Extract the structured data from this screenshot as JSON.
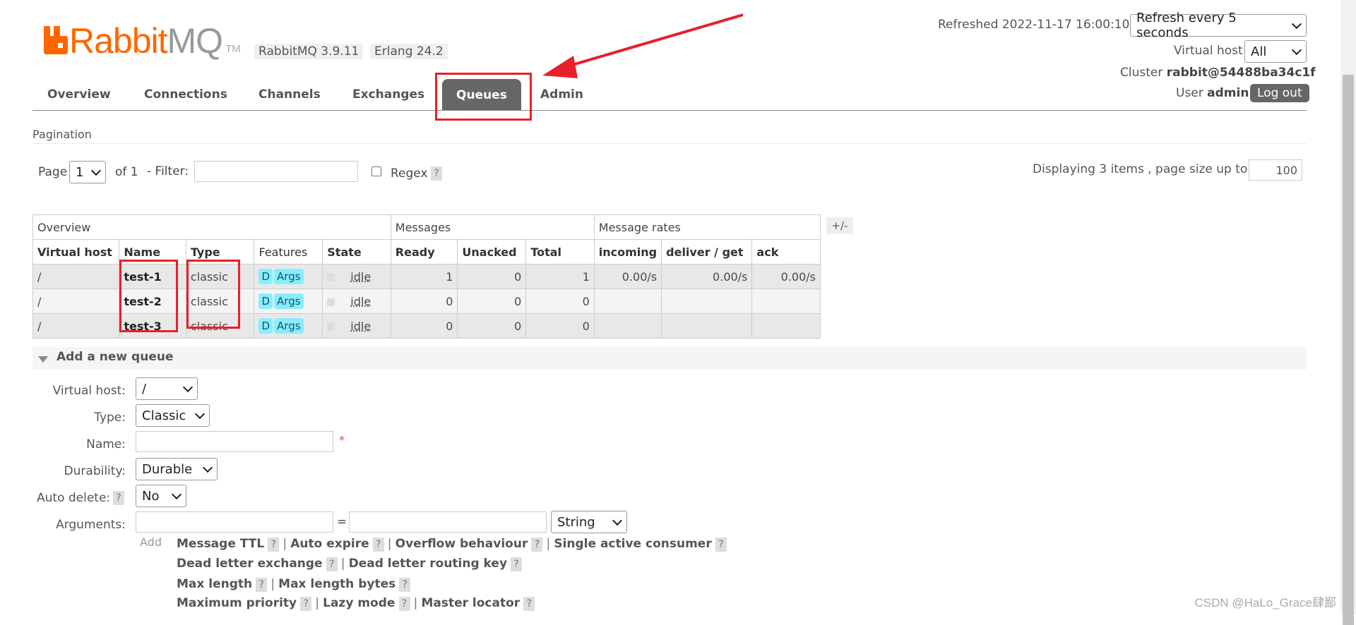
{
  "header": {
    "logo_rabbit": "Rabbit",
    "logo_mq": "MQ",
    "logo_tm": "TM",
    "version": "RabbitMQ 3.9.11",
    "erlang": "Erlang 24.2",
    "refreshed_label": "Refreshed 2022-11-17 16:00:10",
    "refresh_select": "Refresh every 5 seconds",
    "virtual_host_label": "Virtual host",
    "virtual_host_select": "All",
    "cluster_label": "Cluster",
    "cluster_value": "rabbit@54488ba34c1f",
    "user_label": "User",
    "user_value": "admin",
    "logout": "Log out"
  },
  "tabs": [
    "Overview",
    "Connections",
    "Channels",
    "Exchanges",
    "Queues",
    "Admin"
  ],
  "active_tab": "Queues",
  "pagination": {
    "title": "Pagination",
    "page_label": "Page",
    "page_value": "1",
    "of_label": "of 1",
    "filter_label": "- Filter:",
    "filter_value": "",
    "regex_label": "Regex",
    "help": "?",
    "displaying": "Displaying 3 items , page size up to:",
    "page_size": "100"
  },
  "table": {
    "groups": [
      "Overview",
      "Messages",
      "Message rates"
    ],
    "plusminus": "+/-",
    "columns": [
      "Virtual host",
      "Name",
      "Type",
      "Features",
      "State",
      "Ready",
      "Unacked",
      "Total",
      "incoming",
      "deliver / get",
      "ack"
    ],
    "rows": [
      {
        "vhost": "/",
        "name": "test-1",
        "type": "classic",
        "feat_d": "D",
        "feat_args": "Args",
        "state": "idle",
        "ready": "1",
        "unacked": "0",
        "total": "1",
        "incoming": "0.00/s",
        "deliver": "0.00/s",
        "ack": "0.00/s"
      },
      {
        "vhost": "/",
        "name": "test-2",
        "type": "classic",
        "feat_d": "D",
        "feat_args": "Args",
        "state": "idle",
        "ready": "0",
        "unacked": "0",
        "total": "0",
        "incoming": "",
        "deliver": "",
        "ack": ""
      },
      {
        "vhost": "/",
        "name": "test-3",
        "type": "classic",
        "feat_d": "D",
        "feat_args": "Args",
        "state": "idle",
        "ready": "0",
        "unacked": "0",
        "total": "0",
        "incoming": "",
        "deliver": "",
        "ack": ""
      }
    ]
  },
  "add_queue": {
    "title": "Add a new queue",
    "vhost_label": "Virtual host:",
    "vhost_value": "/",
    "type_label": "Type:",
    "type_value": "Classic",
    "name_label": "Name:",
    "name_value": "",
    "required": "*",
    "durability_label": "Durability:",
    "durability_value": "Durable",
    "autodelete_label": "Auto delete:",
    "autodelete_value": "No",
    "arguments_label": "Arguments:",
    "equals": "=",
    "arg_type": "String",
    "add_label": "Add",
    "options_line1": [
      "Message TTL",
      "Auto expire",
      "Overflow behaviour",
      "Single active consumer"
    ],
    "options_line2": [
      "Dead letter exchange",
      "Dead letter routing key"
    ],
    "options_line3": [
      "Max length",
      "Max length bytes"
    ],
    "options_line4": [
      "Maximum priority",
      "Lazy mode",
      "Master locator"
    ],
    "sep": "|"
  },
  "watermark": "CSDN @HaLo_Grace肆鄙",
  "colors": {
    "brand": "#ff6600",
    "annotation": "#e8202a",
    "tab_active": "#666666",
    "badge": "#88eeff"
  }
}
